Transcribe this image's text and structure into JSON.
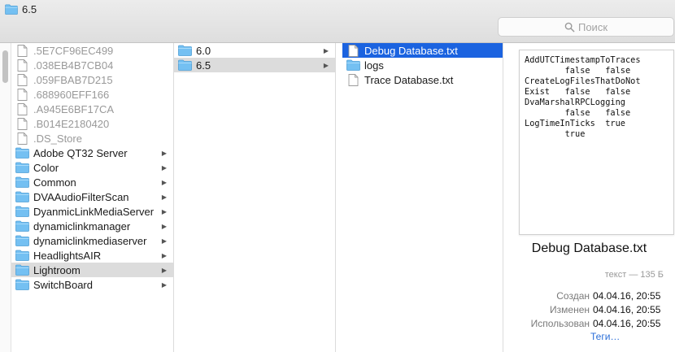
{
  "window": {
    "title": "6.5",
    "title_icon": "folder-icon"
  },
  "search": {
    "placeholder": "Поиск",
    "icon": "search-icon"
  },
  "column1": {
    "items": [
      {
        "label": ".5E7CF96EC499",
        "kind": "file",
        "dim": true
      },
      {
        "label": ".038EB4B7CB04",
        "kind": "file",
        "dim": true
      },
      {
        "label": ".059FBAB7D215",
        "kind": "file",
        "dim": true
      },
      {
        "label": ".688960EFF166",
        "kind": "file",
        "dim": true
      },
      {
        "label": ".A945E6BF17CA",
        "kind": "file",
        "dim": true
      },
      {
        "label": ".B014E2180420",
        "kind": "file",
        "dim": true
      },
      {
        "label": ".DS_Store",
        "kind": "file",
        "dim": true
      },
      {
        "label": "Adobe QT32 Server",
        "kind": "folder"
      },
      {
        "label": "Color",
        "kind": "folder"
      },
      {
        "label": "Common",
        "kind": "folder"
      },
      {
        "label": "DVAAudioFilterScan",
        "kind": "folder"
      },
      {
        "label": "DyanmicLinkMediaServer",
        "kind": "folder"
      },
      {
        "label": "dynamiclinkmanager",
        "kind": "folder"
      },
      {
        "label": "dynamiclinkmediaserver",
        "kind": "folder"
      },
      {
        "label": "HeadlightsAIR",
        "kind": "folder"
      },
      {
        "label": "Lightroom",
        "kind": "folder",
        "selected": "gray"
      },
      {
        "label": "SwitchBoard",
        "kind": "folder"
      }
    ]
  },
  "column2": {
    "items": [
      {
        "label": "6.0",
        "kind": "folder"
      },
      {
        "label": "6.5",
        "kind": "folder",
        "selected": "gray"
      }
    ]
  },
  "column3": {
    "items": [
      {
        "label": "Debug Database.txt",
        "kind": "file",
        "selected": "blue"
      },
      {
        "label": "logs",
        "kind": "folder"
      },
      {
        "label": "Trace Database.txt",
        "kind": "file"
      }
    ]
  },
  "preview": {
    "content": "AddUTCTimestampToTraces\n        false   false\nCreateLogFilesThatDoNot\nExist   false   false\nDvaMarshalRPCLogging\n        false   false\nLogTimeInTicks  true\n        true",
    "file_name": "Debug Database.txt",
    "kind_size": "текст — 135 Б",
    "meta": [
      {
        "key": "Создан",
        "value": "04.04.16, 20:55"
      },
      {
        "key": "Изменен",
        "value": "04.04.16, 20:55"
      },
      {
        "key": "Использован",
        "value": "04.04.16, 20:55"
      }
    ],
    "tags_link": "Теги…"
  },
  "colors": {
    "selection_blue": "#1b63e0",
    "selection_gray": "#dcdcdc",
    "folder_blue": "#74c0f2",
    "link": "#2a6ed8"
  }
}
